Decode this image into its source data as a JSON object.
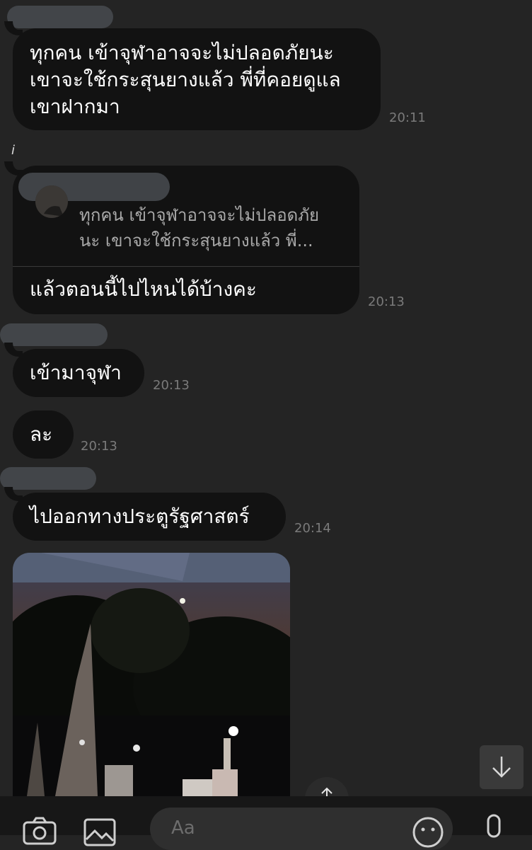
{
  "messages": [
    {
      "lines": [
        "ทุกคน เข้าจุฬาอาจจะไม่ปลอดภัยนะ",
        "เขาจะใช้กระสุนยางแล้ว พี่ที่คอยดูแล",
        "เขาฝากมา"
      ],
      "time": "20:11"
    },
    {
      "stray_char": "i"
    },
    {
      "quote_lines": [
        "ทุกคน เข้าจุฬาอาจจะไม่ปลอดภัย",
        "นะ เขาจะใช้กระสุนยางแล้ว พี่..."
      ],
      "reply": "แล้วตอนนี้ไปไหนได้บ้างคะ",
      "time": "20:13"
    },
    {
      "text": "เข้ามาจุฬา",
      "time": "20:13"
    },
    {
      "text": "ละ",
      "time": "20:13"
    },
    {
      "text": "ไปออกทางประตูรัฐศาสตร์",
      "time": "20:14"
    }
  ],
  "composer": {
    "placeholder": "Aa"
  },
  "icons": {
    "camera": "camera-icon",
    "gallery": "image-icon",
    "emoji": "smiley-icon",
    "mic": "microphone-icon",
    "scroll_down": "arrow-down-icon",
    "share": "share-icon"
  }
}
